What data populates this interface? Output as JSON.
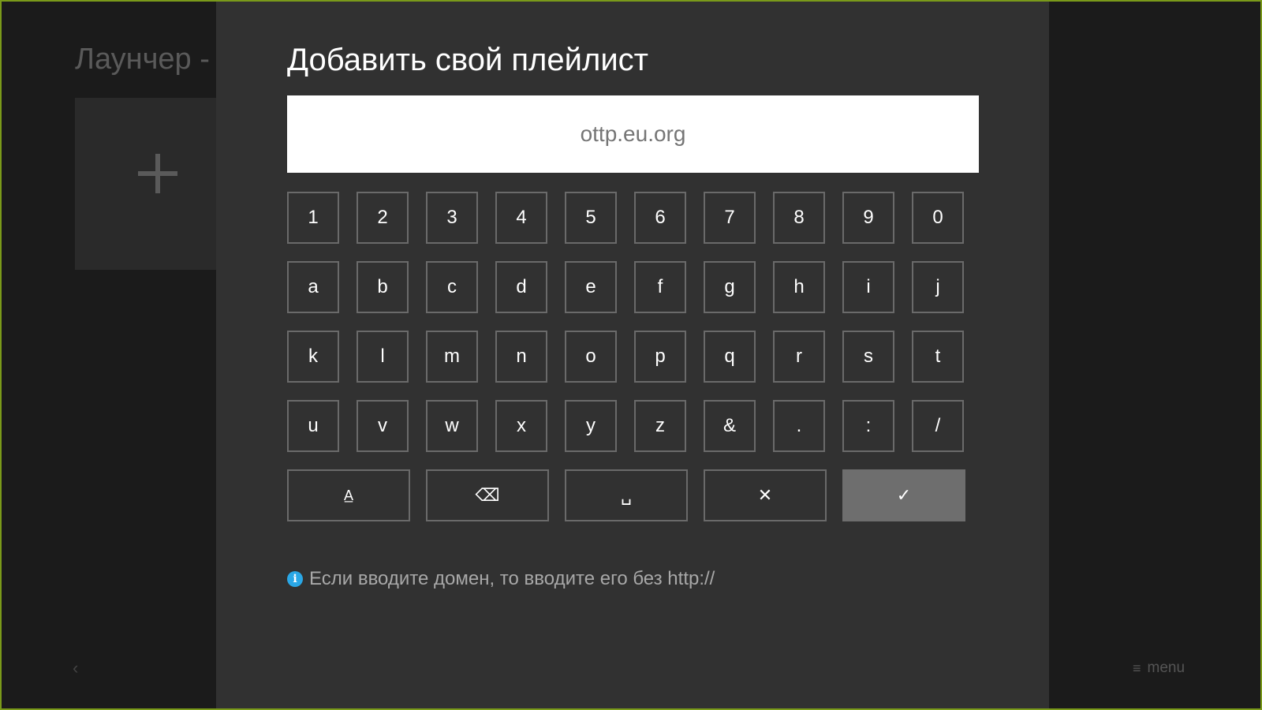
{
  "background": {
    "title": "Лаунчер -",
    "add_tile_icon": "plus-icon",
    "back_icon": "chevron-left-icon",
    "menu_icon": "hamburger-icon",
    "menu_label": "menu"
  },
  "dialog": {
    "title": "Добавить свой плейлист",
    "input": {
      "value": "",
      "placeholder": "ottp.eu.org"
    },
    "keyboard": {
      "rows": [
        [
          "1",
          "2",
          "3",
          "4",
          "5",
          "6",
          "7",
          "8",
          "9",
          "0"
        ],
        [
          "a",
          "b",
          "c",
          "d",
          "e",
          "f",
          "g",
          "h",
          "i",
          "j"
        ],
        [
          "k",
          "l",
          "m",
          "n",
          "o",
          "p",
          "q",
          "r",
          "s",
          "t"
        ],
        [
          "u",
          "v",
          "w",
          "x",
          "y",
          "z",
          "&",
          ".",
          ":",
          "/"
        ]
      ],
      "actions": [
        {
          "name": "caps-button",
          "icon": "caps-icon",
          "glyph": "A̲"
        },
        {
          "name": "backspace-button",
          "icon": "backspace-icon",
          "glyph": "⌫"
        },
        {
          "name": "space-button",
          "icon": "space-icon",
          "glyph": "␣"
        },
        {
          "name": "clear-button",
          "icon": "close-icon",
          "glyph": "✕"
        },
        {
          "name": "confirm-button",
          "icon": "checkmark-icon",
          "glyph": "✓"
        }
      ]
    },
    "hint": {
      "icon": "info-icon",
      "text": "Если вводите домен, то вводите его без http://"
    }
  },
  "colors": {
    "frame_border": "#7a9a1a",
    "dialog_bg": "#313131",
    "info_accent": "#2aa7e6"
  }
}
